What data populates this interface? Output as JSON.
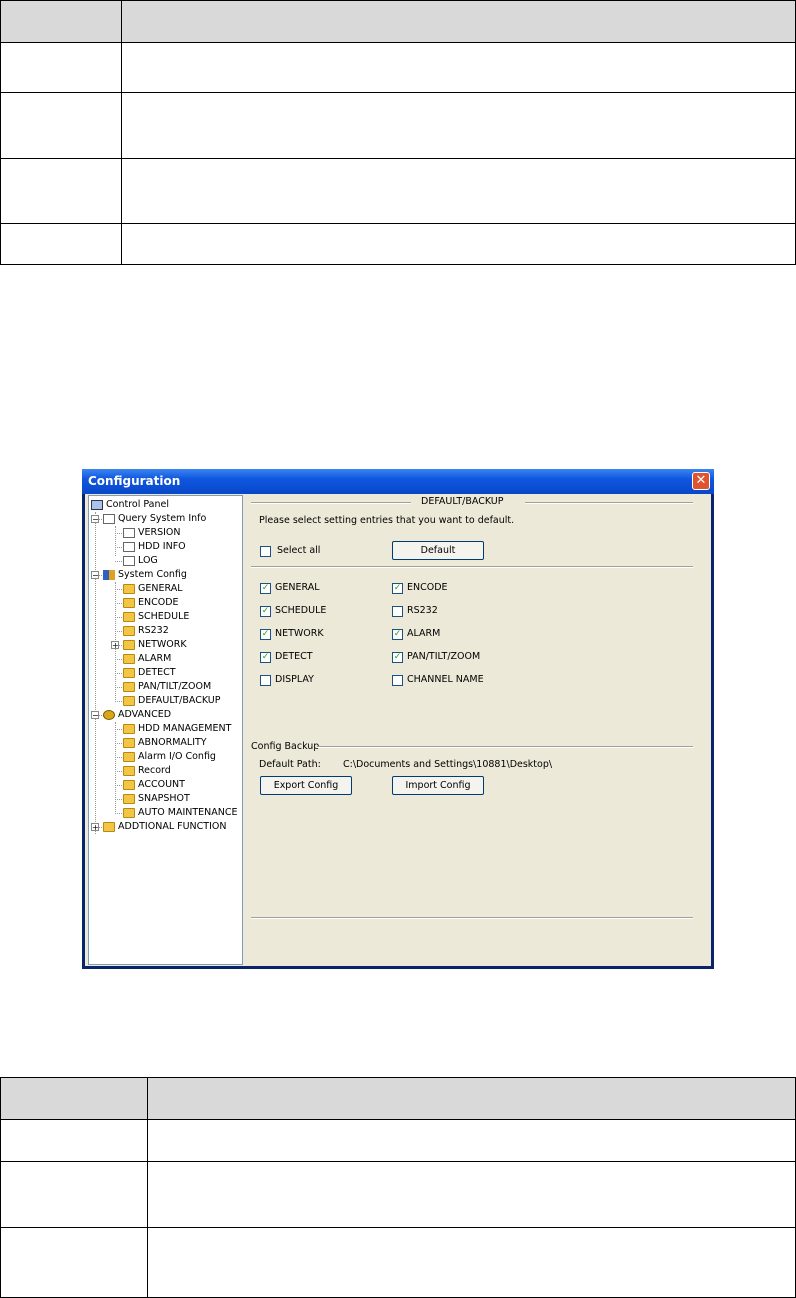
{
  "window": {
    "title": "Configuration"
  },
  "tree": [
    {
      "label": "Control Panel",
      "icon": "computer-icon",
      "level": 0
    },
    {
      "label": "Query System Info",
      "icon": "note-icon",
      "level": 1
    },
    {
      "label": "VERSION",
      "icon": "note-icon",
      "level": 2
    },
    {
      "label": "HDD INFO",
      "icon": "note-icon",
      "level": 2
    },
    {
      "label": "LOG",
      "icon": "note-icon",
      "level": 2
    },
    {
      "label": "System Config",
      "icon": "config-icon",
      "level": 1
    },
    {
      "label": "GENERAL",
      "icon": "folder-icon",
      "level": 2
    },
    {
      "label": "ENCODE",
      "icon": "folder-icon",
      "level": 2
    },
    {
      "label": "SCHEDULE",
      "icon": "folder-icon",
      "level": 2
    },
    {
      "label": "RS232",
      "icon": "folder-icon",
      "level": 2
    },
    {
      "label": "NETWORK",
      "icon": "folder-icon",
      "level": 2
    },
    {
      "label": "ALARM",
      "icon": "folder-icon",
      "level": 2
    },
    {
      "label": "DETECT",
      "icon": "folder-icon",
      "level": 2
    },
    {
      "label": "PAN/TILT/ZOOM",
      "icon": "folder-icon",
      "level": 2
    },
    {
      "label": "DEFAULT/BACKUP",
      "icon": "folder-open-icon",
      "level": 2
    },
    {
      "label": "ADVANCED",
      "icon": "gear-icon",
      "level": 1
    },
    {
      "label": "HDD MANAGEMENT",
      "icon": "folder-icon",
      "level": 2
    },
    {
      "label": "ABNORMALITY",
      "icon": "folder-icon",
      "level": 2
    },
    {
      "label": "Alarm I/O Config",
      "icon": "folder-icon",
      "level": 2
    },
    {
      "label": "Record",
      "icon": "folder-icon",
      "level": 2
    },
    {
      "label": "ACCOUNT",
      "icon": "folder-icon",
      "level": 2
    },
    {
      "label": "SNAPSHOT",
      "icon": "folder-icon",
      "level": 2
    },
    {
      "label": "AUTO MAINTENANCE",
      "icon": "folder-icon",
      "level": 2
    },
    {
      "label": "ADDTIONAL FUNCTION",
      "icon": "folder-icon",
      "level": 1
    }
  ],
  "panel": {
    "section_title": "DEFAULT/BACKUP",
    "instruction": "Please select setting entries that you want to default.",
    "select_all_label": "Select all",
    "select_all_checked": false,
    "default_button": "Default",
    "options_left": [
      {
        "label": "GENERAL",
        "checked": true
      },
      {
        "label": "SCHEDULE",
        "checked": true
      },
      {
        "label": "NETWORK",
        "checked": true
      },
      {
        "label": "DETECT",
        "checked": true
      },
      {
        "label": "DISPLAY",
        "checked": false
      }
    ],
    "options_right": [
      {
        "label": "ENCODE",
        "checked": true
      },
      {
        "label": "RS232",
        "checked": false
      },
      {
        "label": "ALARM",
        "checked": true
      },
      {
        "label": "PAN/TILT/ZOOM",
        "checked": true
      },
      {
        "label": "CHANNEL NAME",
        "checked": false
      }
    ],
    "backup_title": "Config Backup",
    "default_path_label": "Default Path:",
    "default_path_value": "C:\\Documents and Settings\\10881\\Desktop\\",
    "export_button": "Export Config",
    "import_button": "Import Config"
  }
}
